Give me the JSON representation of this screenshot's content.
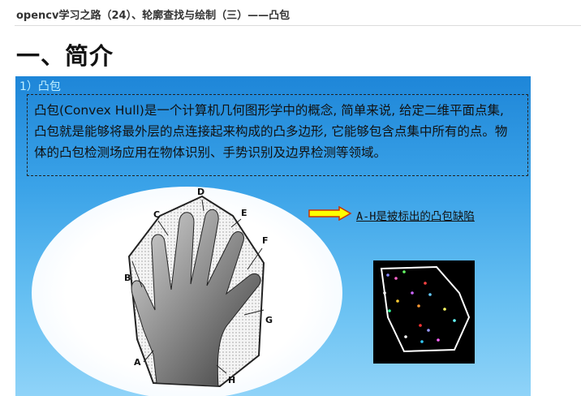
{
  "post": {
    "title": "opencv学习之路（24）、轮廓查找与绘制（三）——凸包"
  },
  "section": {
    "heading": "一、简介"
  },
  "slide": {
    "label": "1）凸包",
    "description": "凸包(Convex Hull)是一个计算机几何图形学中的概念, 简单来说, 给定二维平面点集, 凸包就是能够将最外层的点连接起来构成的凸多边形, 它能够包含点集中所有的点。物体的凸包检测场应用在物体识别、手势识别及边界检测等领域。",
    "defect_note": "A-H是被标出的凸包缺陷",
    "hand_labels": [
      "A",
      "B",
      "C",
      "D",
      "E",
      "F",
      "G",
      "H"
    ]
  },
  "colors": {
    "slide_top": "#1e86d8",
    "slide_bottom": "#8fd3f8",
    "arrow_fill": "#ffff00",
    "arrow_outline": "#cc3300",
    "hull_line": "#ffffff"
  },
  "icons": {
    "arrow": "right-arrow-icon"
  }
}
